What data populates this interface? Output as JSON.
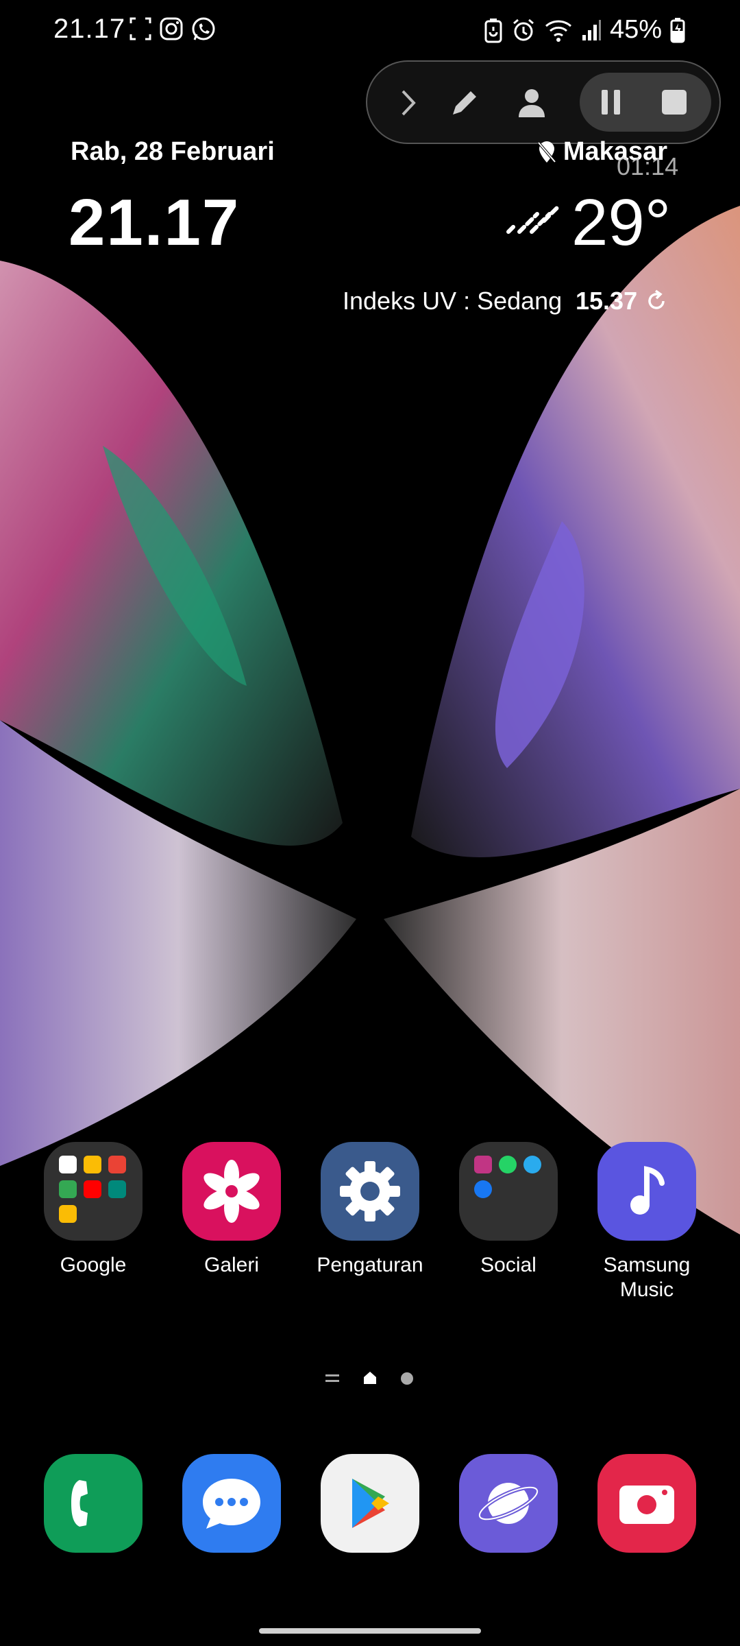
{
  "status_bar": {
    "time": "21.17",
    "battery_percent": "45%",
    "left_icons": [
      "screenshot-icon",
      "instagram-icon",
      "whatsapp-icon"
    ],
    "right_icons": [
      "battery-saver-icon",
      "alarm-icon",
      "wifi-icon",
      "signal-icon",
      "battery-charging-icon"
    ]
  },
  "recorder": {
    "timer": "01:14",
    "buttons": [
      "chevron-right-icon",
      "pencil-icon",
      "person-icon",
      "pause-icon",
      "stop-icon"
    ]
  },
  "widget": {
    "date": "Rab, 28 Februari",
    "time": "21.17",
    "location": "Makasar",
    "temperature": "29°",
    "uv_index": "Indeks UV : Sedang",
    "updated_time": "15.37"
  },
  "apps": [
    {
      "label": "Google",
      "kind": "folder"
    },
    {
      "label": "Galeri",
      "kind": "gallery"
    },
    {
      "label": "Pengaturan",
      "kind": "settings"
    },
    {
      "label": "Social",
      "kind": "folder"
    },
    {
      "label": "Samsung\nMusic",
      "label_line1": "Samsung",
      "label_line2": "Music",
      "kind": "music"
    }
  ],
  "dock": [
    {
      "name": "phone",
      "color": "#0f9d58"
    },
    {
      "name": "messages",
      "color": "#2f7cf0"
    },
    {
      "name": "play-store",
      "color": "#f1f1f1"
    },
    {
      "name": "internet",
      "color": "#6b5bd8"
    },
    {
      "name": "camera",
      "color": "#e3264a"
    }
  ],
  "colors": {
    "galeri": "#d9115e",
    "pengaturan": "#3a5a8c",
    "music": "#5a55e0"
  }
}
